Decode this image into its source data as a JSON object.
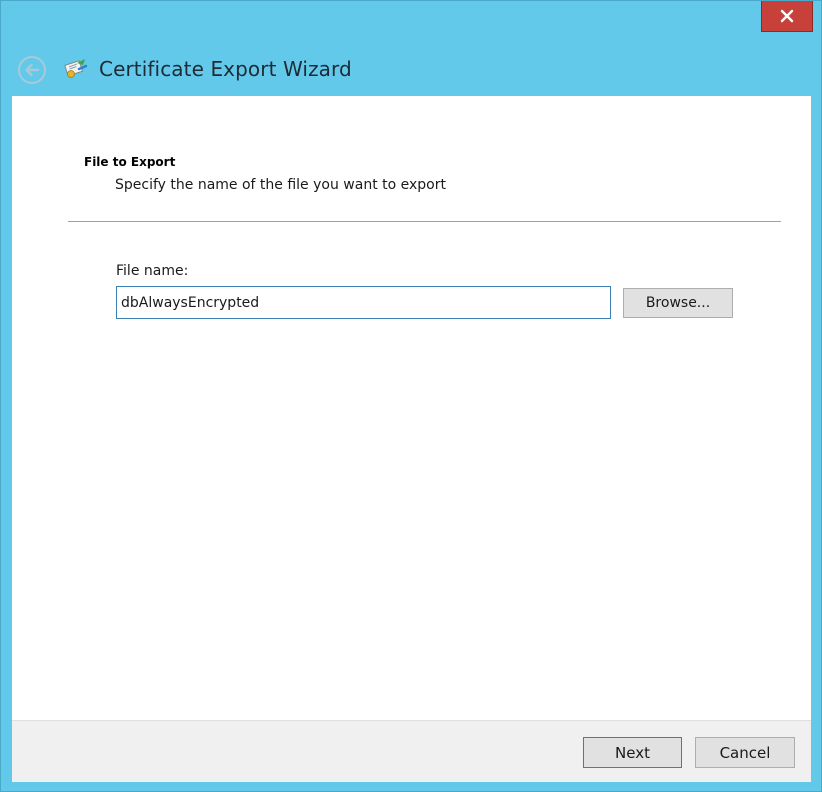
{
  "window": {
    "title": "Certificate Export Wizard",
    "close_label": "x"
  },
  "page": {
    "section_title": "File to Export",
    "section_description": "Specify the name of the file you want to export"
  },
  "form": {
    "file_name_label": "File name:",
    "file_name_value": "dbAlwaysEncrypted",
    "browse_label": "Browse..."
  },
  "footer": {
    "next_label": "Next",
    "cancel_label": "Cancel"
  },
  "icons": {
    "close": "close-icon",
    "back": "back-arrow-icon",
    "title": "certificate-icon"
  },
  "colors": {
    "titlebar": "#62c9ea",
    "close_button": "#c7413a",
    "input_border": "#3c7fb1",
    "footer_background": "#f0f0f0"
  }
}
